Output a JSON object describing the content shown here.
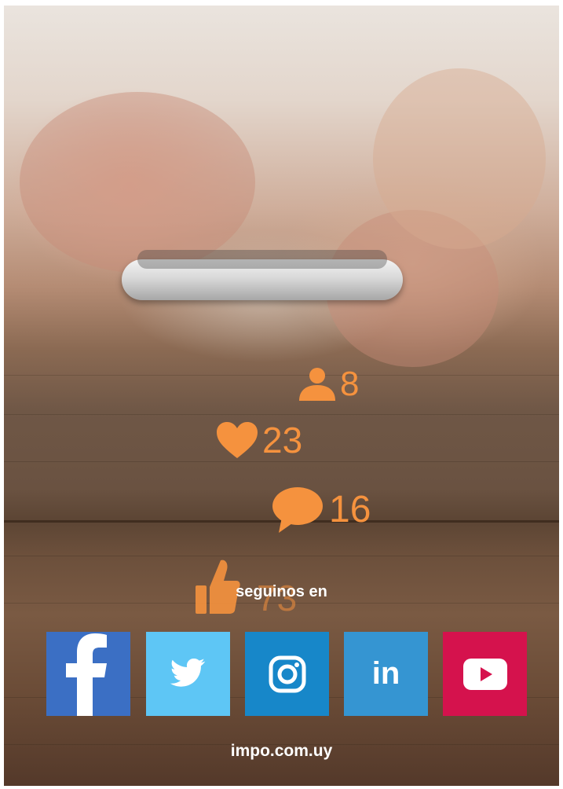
{
  "stats": [
    {
      "icon": "user-icon",
      "value": "8"
    },
    {
      "icon": "heart-icon",
      "value": "23"
    },
    {
      "icon": "speech-bubble-icon",
      "value": "16"
    },
    {
      "icon": "thumbs-up-icon",
      "value": "73"
    }
  ],
  "follow_text": "seguinos en",
  "social": [
    {
      "name": "facebook",
      "icon": "facebook-icon",
      "color": "#3b6fc4"
    },
    {
      "name": "twitter",
      "icon": "twitter-icon",
      "color": "#5ec6f5"
    },
    {
      "name": "instagram",
      "icon": "instagram-icon",
      "color": "#1787c9"
    },
    {
      "name": "linkedin",
      "icon": "linkedin-icon",
      "color": "#3595d2",
      "label": "in"
    },
    {
      "name": "youtube",
      "icon": "youtube-icon",
      "color": "#d5124d"
    }
  ],
  "website": "impo.com.uy",
  "colors": {
    "accent": "#f5923e",
    "text": "#ffffff"
  }
}
